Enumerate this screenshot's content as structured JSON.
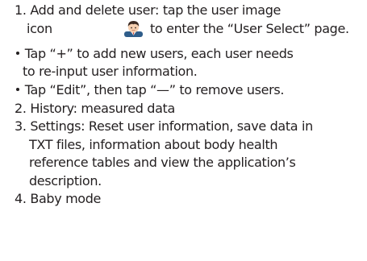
{
  "items": [
    {
      "num": "1.",
      "lines": [
        "Add and delete user: tap the user image",
        "icon",
        "to enter the “User Select” page."
      ],
      "icon": "user-avatar-icon",
      "bullets": [
        [
          "Tap “+” to add new users, each user needs",
          "to re-input user information."
        ],
        [
          "Tap “Edit”, then tap “—” to remove users."
        ]
      ]
    },
    {
      "num": "2.",
      "lines": [
        "History: measured data"
      ]
    },
    {
      "num": "3.",
      "lines": [
        "Settings: Reset user information, save data in",
        "TXT files, information about body health",
        "reference tables and view the application’s",
        "description."
      ]
    },
    {
      "num": "4.",
      "lines": [
        "Baby mode"
      ]
    }
  ]
}
